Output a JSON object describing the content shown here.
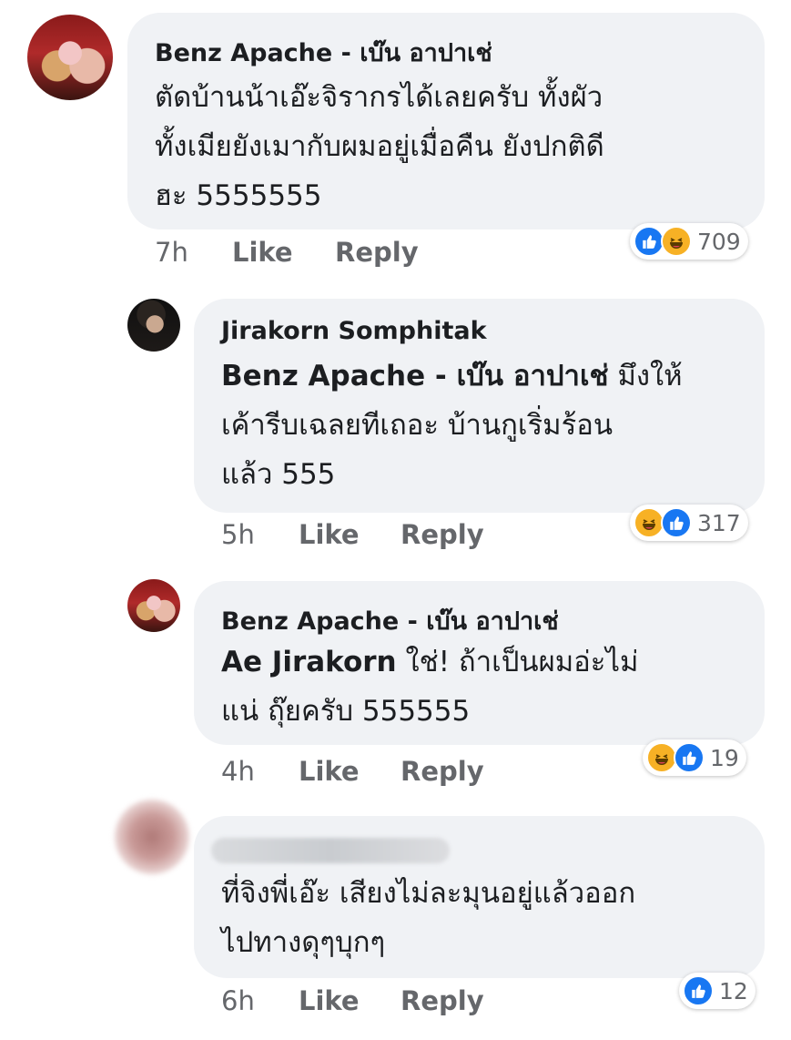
{
  "comments": [
    {
      "author": "Benz Apache - เบ๊น อาปาเช่",
      "lines": [
        "ตัดบ้านน้าเอ๊ะจิรากรได้เลยครับ  ทั้งผัว",
        "ทั้งเมียยังเมากับผมอยู่เมื่อคืน ยังปกติดี",
        "ฮะ 5555555"
      ],
      "time": "7h",
      "like_label": "Like",
      "reply_label": "Reply",
      "reaction_count": "709",
      "reactions": [
        "like-icon",
        "haha-icon"
      ]
    },
    {
      "author": "Jirakorn Somphitak",
      "tag": "Benz Apache - เบ๊น อาปาเช่",
      "line1_rest": " มึงให้",
      "lines": [
        "เค้ารีบเฉลยทีเถอะ บ้านกูเริ่มร้อน",
        "แล้ว 555"
      ],
      "time": "5h",
      "like_label": "Like",
      "reply_label": "Reply",
      "reaction_count": "317",
      "reactions": [
        "haha-icon",
        "like-icon"
      ]
    },
    {
      "author": "Benz Apache - เบ๊น อาปาเช่",
      "tag": "Ae Jirakorn",
      "line1_rest": "  ใช่!   ถ้าเป็นผมอ่ะไม่",
      "lines": [
        "แน่  ถุ๊ยครับ 555555"
      ],
      "time": "4h",
      "like_label": "Like",
      "reply_label": "Reply",
      "reaction_count": "19",
      "reactions": [
        "haha-icon",
        "like-icon"
      ]
    },
    {
      "lines": [
        "ที่จิงพี่เอ๊ะ เสียงไม่ละมุนอยู่แล้วออก",
        "ไปทางดุๆบุกๆ"
      ],
      "time": "6h",
      "like_label": "Like",
      "reply_label": "Reply",
      "reaction_count": "12",
      "reactions": [
        "like-icon"
      ]
    }
  ],
  "colors": {
    "like": "#1877f2",
    "haha": "#f7b125",
    "bubble": "#f0f2f5",
    "meta": "#65676b"
  }
}
